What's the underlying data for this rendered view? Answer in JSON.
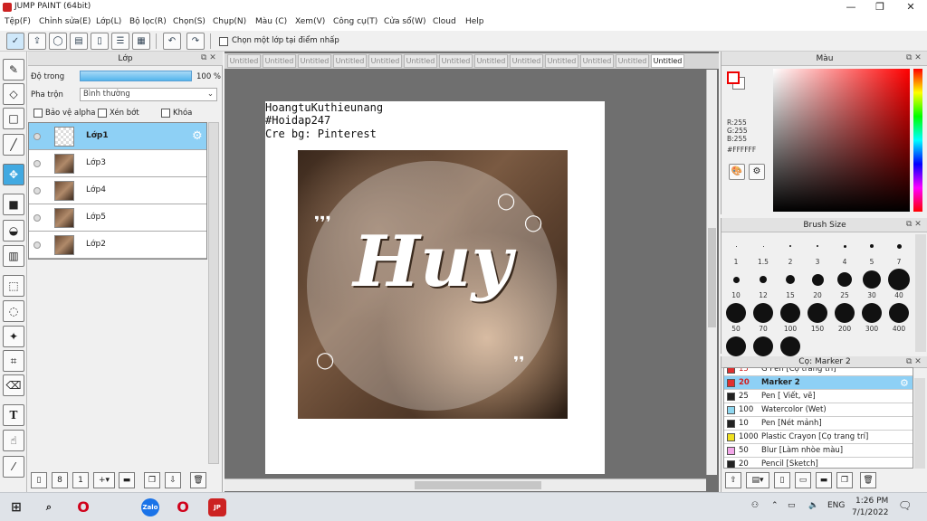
{
  "window": {
    "title": "JUMP PAINT (64bit)",
    "min": "—",
    "max": "❐",
    "close": "✕"
  },
  "menu": [
    "Tệp(F)",
    "Chỉnh sửa(E)",
    "Lớp(L)",
    "Bộ lọc(R)",
    "Chọn(S)",
    "Chụp(N)",
    "Màu (C)",
    "Xem(V)",
    "Công cụ(T)",
    "Cửa sổ(W)",
    "Cloud",
    "Help"
  ],
  "toolbar": {
    "pick_layer_label": "Chọn một lớp tại điểm nhấp"
  },
  "layer_panel": {
    "title": "Lớp",
    "opacity_label": "Độ trong",
    "opacity_value": "100 %",
    "opacity_fraction": 1.0,
    "blend_label": "Pha trộn",
    "blend_value": "Bình thường",
    "protect_alpha": "Bảo vệ alpha",
    "clipping": "Xén bớt",
    "lock": "Khóa",
    "layers": [
      {
        "name": "Lớp1",
        "active": true,
        "blank": true
      },
      {
        "name": "Lớp3",
        "active": false,
        "blank": false
      },
      {
        "name": "Lớp4",
        "active": false,
        "blank": false
      },
      {
        "name": "Lớp5",
        "active": false,
        "blank": false
      },
      {
        "name": "Lớp2",
        "active": false,
        "blank": false
      }
    ]
  },
  "tabs": [
    "Untitled",
    "Untitled",
    "Untitled",
    "Untitled",
    "Untitled",
    "Untitled",
    "Untitled",
    "Untitled",
    "Untitled",
    "Untitled",
    "Untitled",
    "Untitled",
    "Untitled"
  ],
  "canvas": {
    "text_lines": [
      "HoangtuKuthieunang",
      "#Hoidap247",
      "Cre bg: Pinterest"
    ],
    "art_word": "Huy"
  },
  "color_panel": {
    "title": "Màu",
    "r": "R:255",
    "g": "G:255",
    "b": "B:255",
    "hex": "#FFFFFF"
  },
  "brush_panel": {
    "title": "Brush Size",
    "sizes": [
      "1",
      "1.5",
      "2",
      "3",
      "4",
      "5",
      "7",
      "10",
      "12",
      "15",
      "20",
      "25",
      "30",
      "40",
      "50",
      "70",
      "100",
      "150",
      "200",
      "300",
      "400",
      "",
      "",
      ""
    ]
  },
  "tool_panel": {
    "title": "Cọ: Marker 2",
    "tools": [
      {
        "size": "15",
        "name": "G Pen [Cọ trang trí]",
        "color": "#e03030",
        "active": false
      },
      {
        "size": "20",
        "name": "Marker 2",
        "color": "#e03030",
        "active": true
      },
      {
        "size": "25",
        "name": "Pen [ Viết, vẽ]",
        "color": "#222222",
        "active": false
      },
      {
        "size": "100",
        "name": "Watercolor (Wet)",
        "color": "#8fd7f0",
        "active": false
      },
      {
        "size": "10",
        "name": "Pen [Nét mảnh]",
        "color": "#222222",
        "active": false
      },
      {
        "size": "1000",
        "name": "Plastic Crayon [Cọ trang trí]",
        "color": "#f0e020",
        "active": false
      },
      {
        "size": "50",
        "name": "Blur [Làm nhòe màu]",
        "color": "#f2a6e8",
        "active": false
      },
      {
        "size": "20",
        "name": "Pencil [Sketch]",
        "color": "#222222",
        "active": false
      }
    ]
  },
  "taskbar": {
    "lang": "ENG",
    "time": "1:26 PM",
    "date": "7/1/2022"
  }
}
